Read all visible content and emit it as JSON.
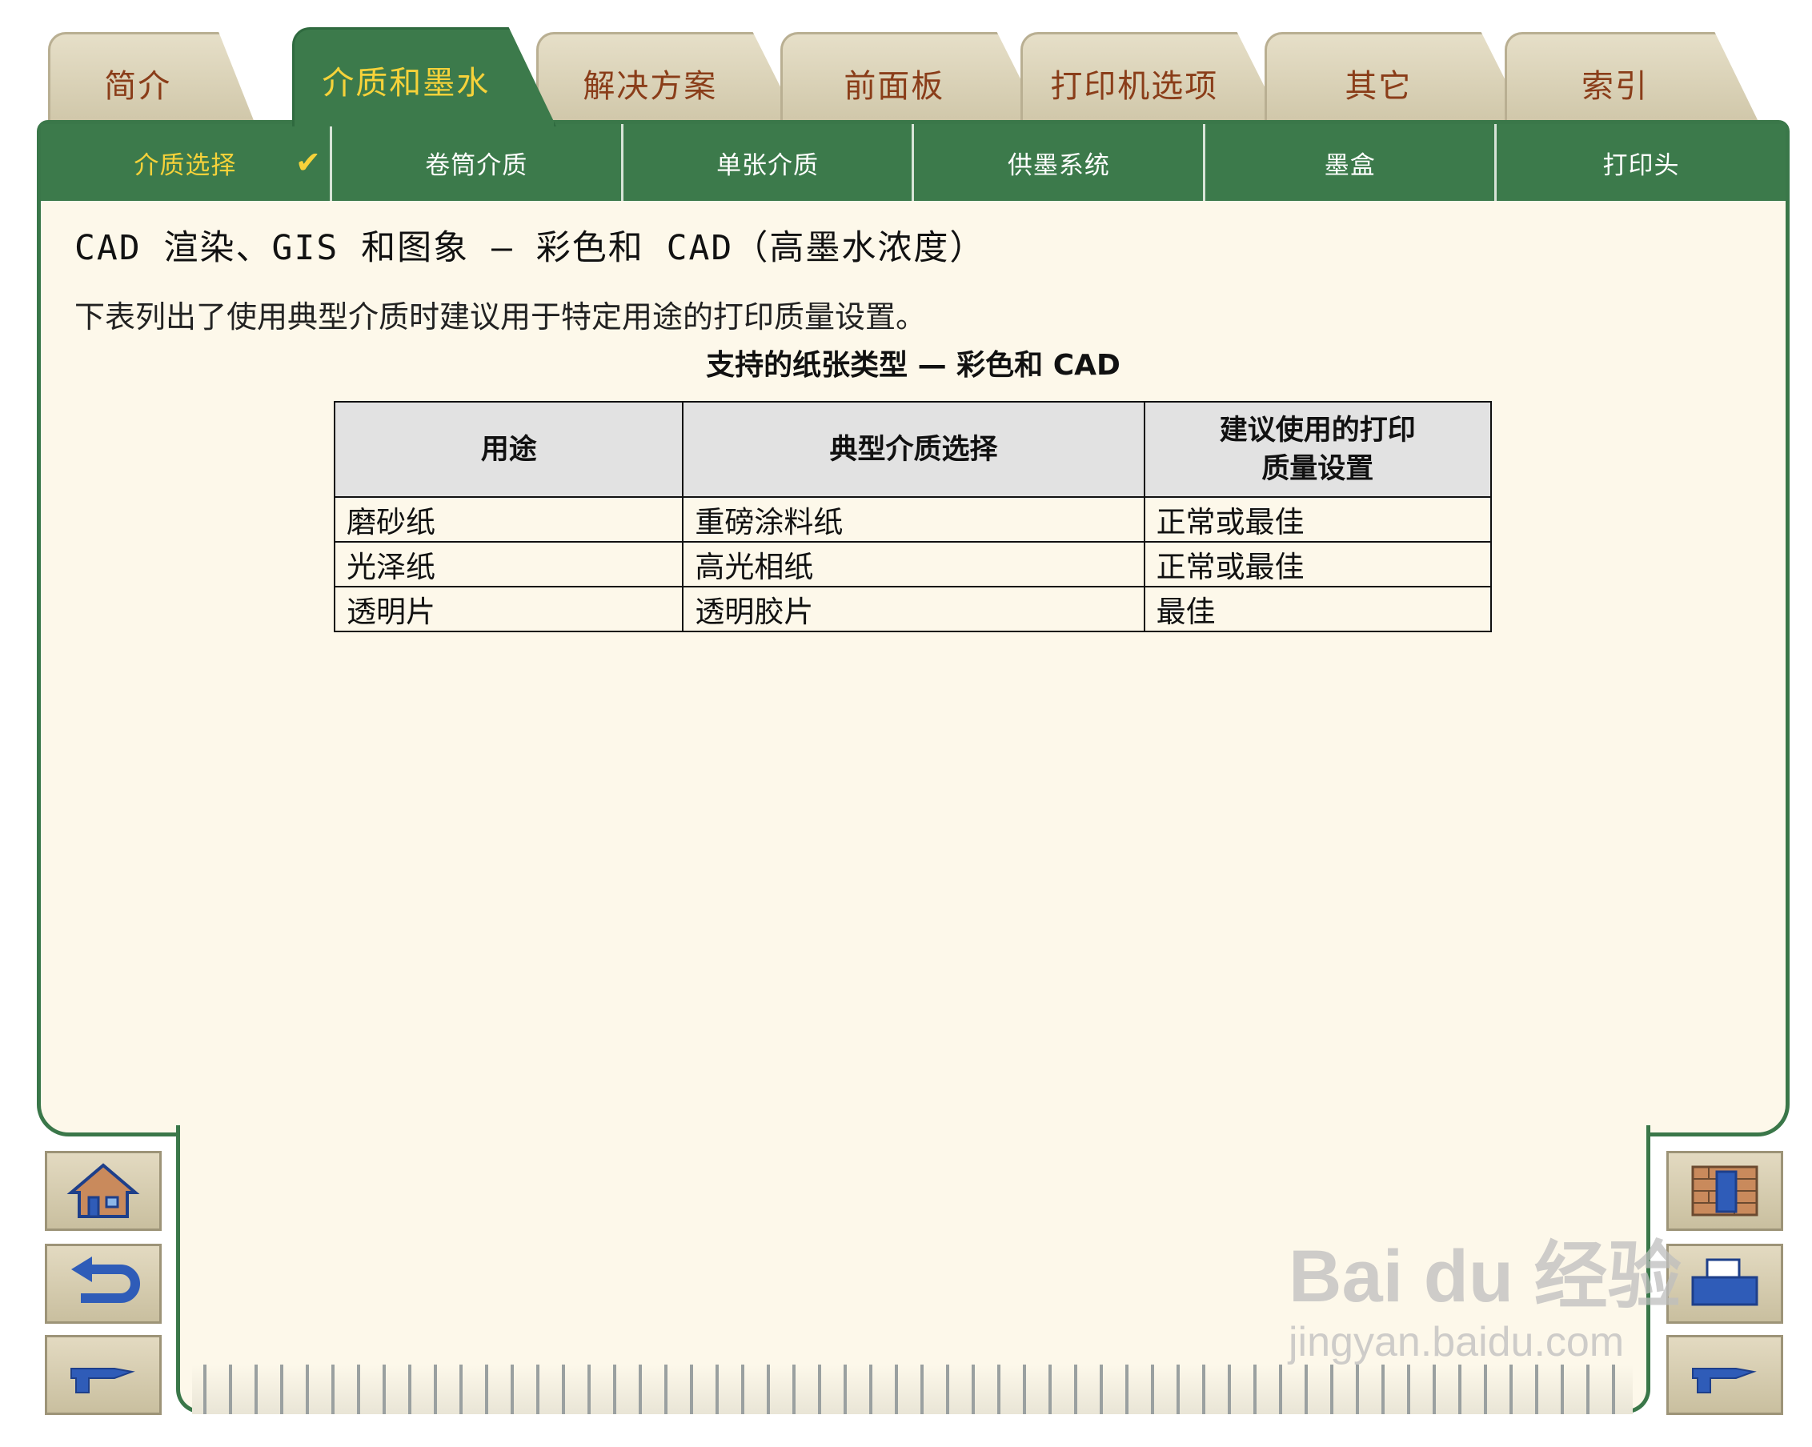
{
  "tabs": [
    {
      "label": "简介"
    },
    {
      "label": "介质和墨水",
      "active": true
    },
    {
      "label": "解决方案"
    },
    {
      "label": "前面板"
    },
    {
      "label": "打印机选项"
    },
    {
      "label": "其它"
    },
    {
      "label": "索引"
    }
  ],
  "subnav": [
    {
      "label": "介质选择",
      "active": true
    },
    {
      "label": "卷筒介质"
    },
    {
      "label": "单张介质"
    },
    {
      "label": "供墨系统"
    },
    {
      "label": "墨盒"
    },
    {
      "label": "打印头"
    }
  ],
  "check_mark": "✔",
  "page": {
    "title": "CAD 渲染、GIS 和图象 — 彩色和 CAD（高墨水浓度）",
    "intro": "下表列出了使用典型介质时建议用于特定用途的打印质量设置。",
    "table_caption": "支持的纸张类型 — 彩色和 CAD"
  },
  "table": {
    "headers": [
      "用途",
      "典型介质选择",
      "建议使用的打印\n质量设置"
    ],
    "rows": [
      [
        "磨砂纸",
        "重磅涂料纸",
        "正常或最佳"
      ],
      [
        "光泽纸",
        "高光相纸",
        "正常或最佳"
      ],
      [
        "透明片",
        "透明胶片",
        "最佳"
      ]
    ]
  },
  "nav_buttons": {
    "left": [
      "home-icon",
      "back-icon",
      "forward-hand-icon"
    ],
    "right": [
      "contents-icon",
      "printer-icon",
      "forward-hand-icon"
    ]
  },
  "watermark": {
    "brand": "Bai du 经验",
    "url": "jingyan.baidu.com"
  }
}
